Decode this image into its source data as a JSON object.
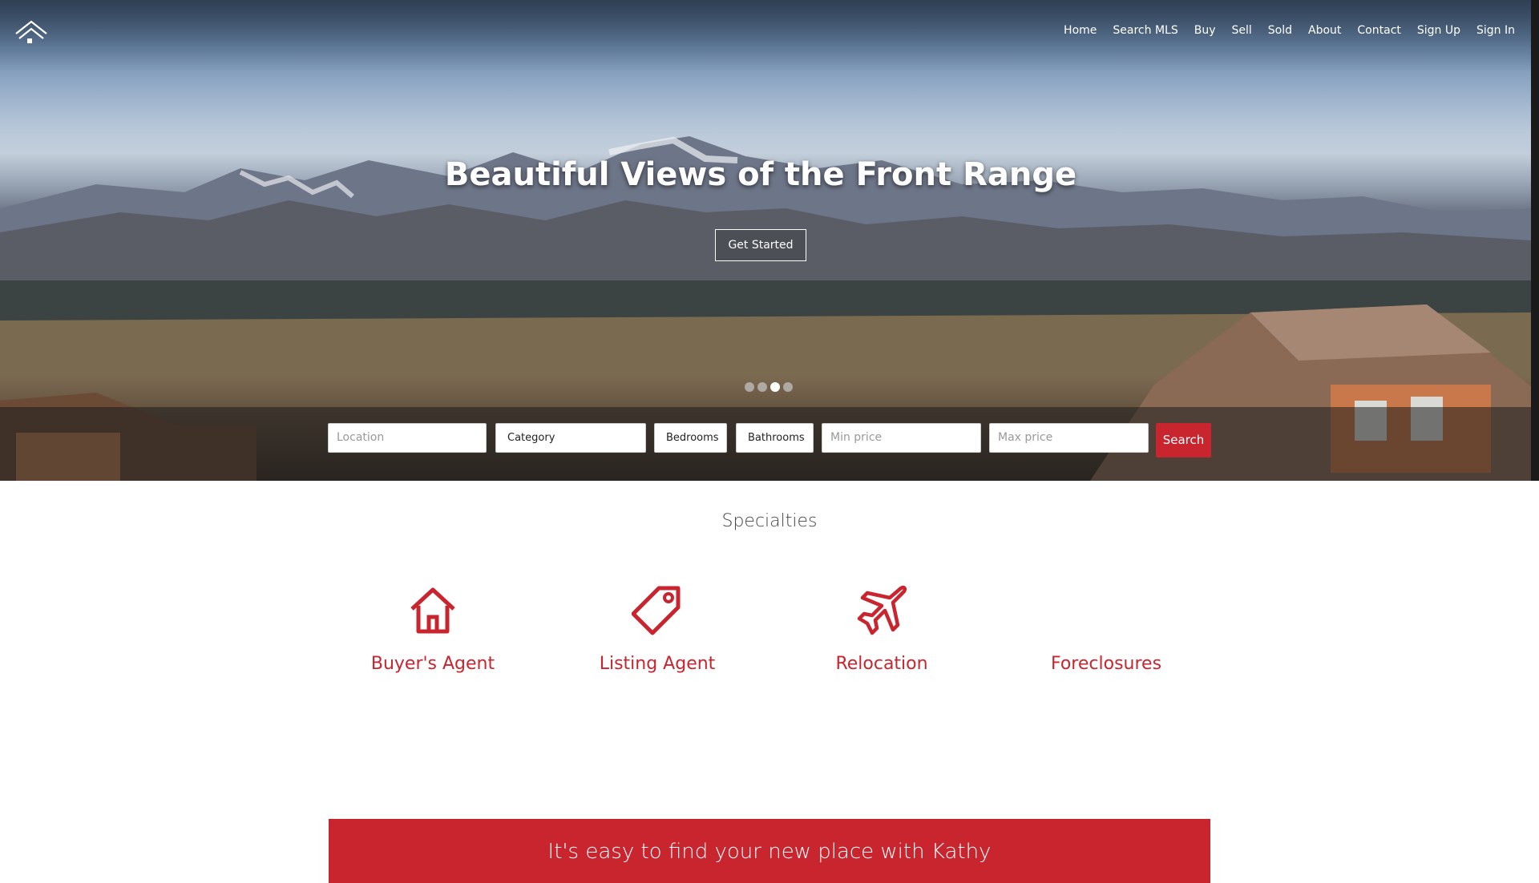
{
  "nav": {
    "items": [
      "Home",
      "Search MLS",
      "Buy",
      "Sell",
      "Sold",
      "About",
      "Contact",
      "Sign Up",
      "Sign In"
    ]
  },
  "logo": {
    "icon": "house-roof-icon"
  },
  "hero": {
    "title": "Beautiful Views of the Front Range",
    "cta_label": "Get Started",
    "slides_total": 4,
    "active_slide": 3
  },
  "search": {
    "location_placeholder": "Location",
    "category_value": "Category",
    "bedrooms_value": "Bedrooms",
    "bathrooms_value": "Bathrooms",
    "min_price_placeholder": "Min price",
    "max_price_placeholder": "Max price",
    "button_label": "Search"
  },
  "specialties": {
    "title": "Specialties",
    "items": [
      {
        "label": "Buyer's Agent",
        "icon": "house-icon"
      },
      {
        "label": "Listing Agent",
        "icon": "tag-icon"
      },
      {
        "label": "Relocation",
        "icon": "airplane-icon"
      },
      {
        "label": "Foreclosures",
        "icon": ""
      }
    ]
  },
  "banner": {
    "text": "It's easy to find your new place with Kathy"
  },
  "colors": {
    "accent": "#c9252f",
    "white": "#ffffff"
  }
}
